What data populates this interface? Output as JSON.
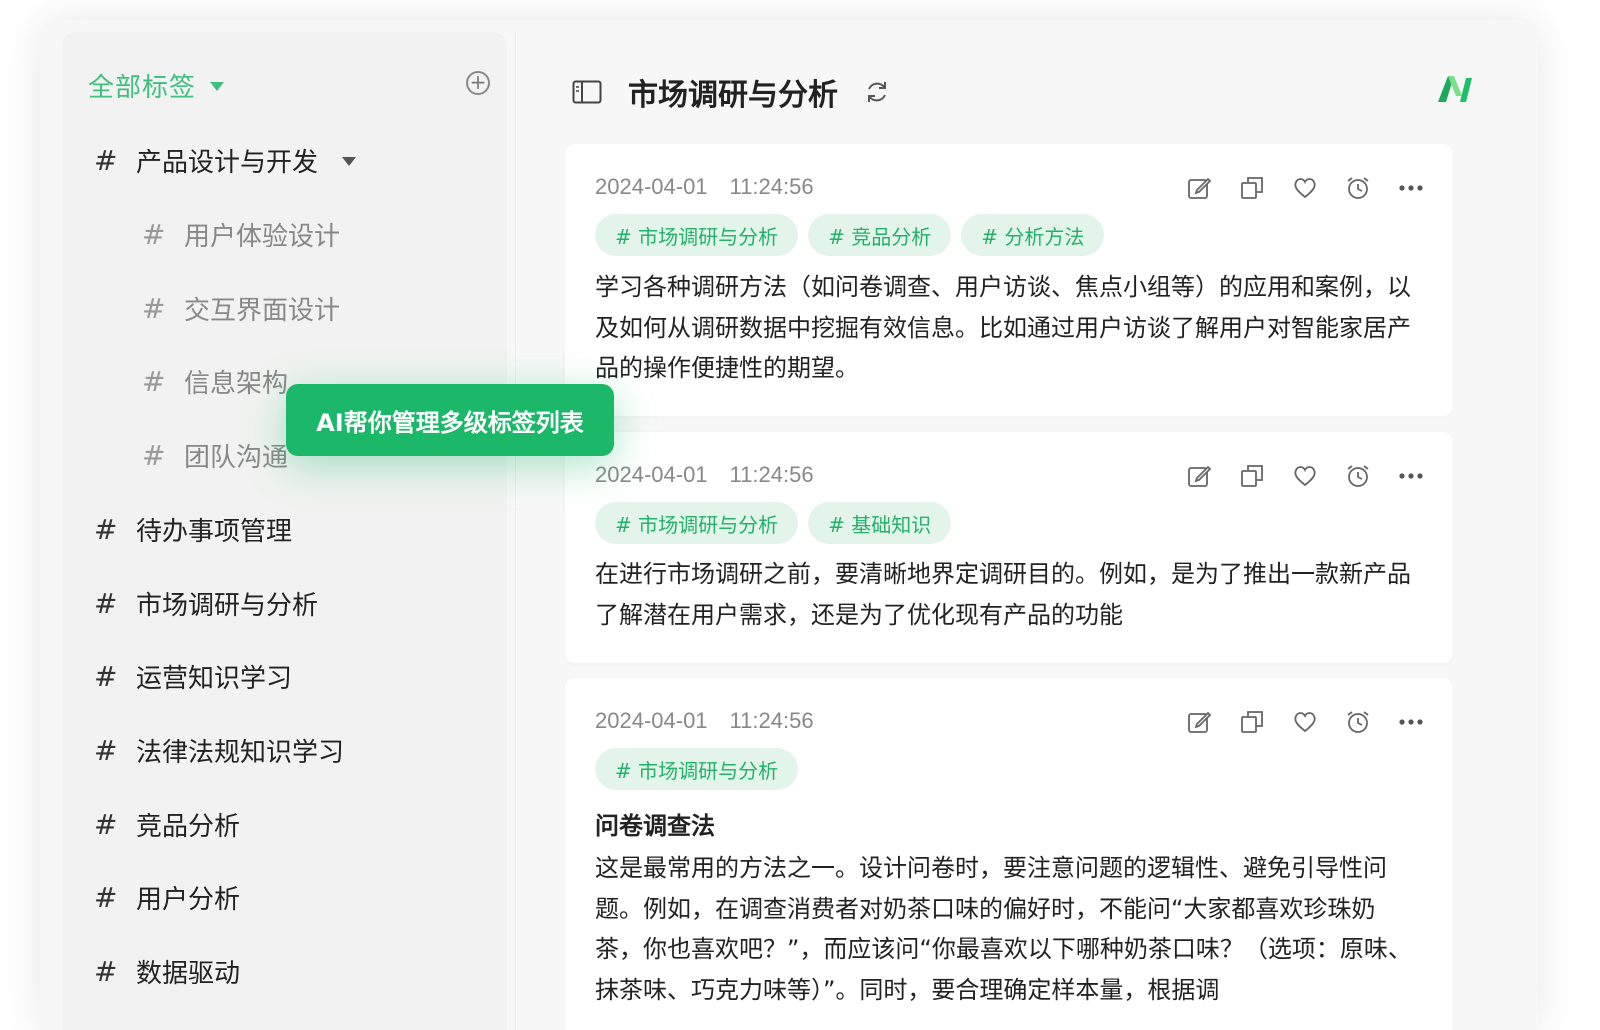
{
  "sidebar": {
    "title": "全部标签",
    "hash": "#",
    "items": [
      {
        "label": "产品设计与开发",
        "level": 0,
        "expanded": true
      },
      {
        "label": "用户体验设计",
        "level": 1
      },
      {
        "label": "交互界面设计",
        "level": 1
      },
      {
        "label": "信息架构",
        "level": 1
      },
      {
        "label": "团队沟通",
        "level": 1
      },
      {
        "label": "待办事项管理",
        "level": 0
      },
      {
        "label": "市场调研与分析",
        "level": 0
      },
      {
        "label": "运营知识学习",
        "level": 0
      },
      {
        "label": "法律法规知识学习",
        "level": 0
      },
      {
        "label": "竞品分析",
        "level": 0
      },
      {
        "label": "用户分析",
        "level": 0
      },
      {
        "label": "数据驱动",
        "level": 0
      }
    ]
  },
  "tooltip": "AI帮你管理多级标签列表",
  "main": {
    "title": "市场调研与分析",
    "cards": [
      {
        "date": "2024-04-01",
        "time": "11:24:56",
        "tags": [
          "# 市场调研与分析",
          "# 竞品分析",
          "# 分析方法"
        ],
        "body": "学习各种调研方法（如问卷调查、用户访谈、焦点小组等）的应用和案例，以及如何从调研数据中挖掘有效信息。比如通过用户访谈了解用户对智能家居产品的操作便捷性的期望。"
      },
      {
        "date": "2024-04-01",
        "time": "11:24:56",
        "tags": [
          "# 市场调研与分析",
          "# 基础知识"
        ],
        "body": "在进行市场调研之前，要清晰地界定调研目的。例如，是为了推出一款新产品了解潜在用户需求，还是为了优化现有产品的功能"
      },
      {
        "date": "2024-04-01",
        "time": "11:24:56",
        "tags": [
          "# 市场调研与分析"
        ],
        "heading": "问卷调查法",
        "body": "这是最常用的方法之一。设计问卷时，要注意问题的逻辑性、避免引导性问题。例如，在调查消费者对奶茶口味的偏好时，不能问“大家都喜欢珍珠奶茶，你也喜欢吧？”，而应该问“你最喜欢以下哪种奶茶口味？（选项：原味、抹茶味、巧克力味等）”。同时，要合理确定样本量，根据调"
      }
    ]
  },
  "colors": {
    "accent": "#3fbf7f",
    "tag_bg": "#e3f5ea",
    "tag_text": "#25b06a",
    "tooltip_bg": "#1bb86a"
  },
  "icons": [
    "add-circle-icon",
    "chevron-down-icon",
    "sidebar-toggle-icon",
    "refresh-icon",
    "app-logo",
    "edit-icon",
    "copy-icon",
    "heart-icon",
    "alarm-icon",
    "more-icon"
  ]
}
